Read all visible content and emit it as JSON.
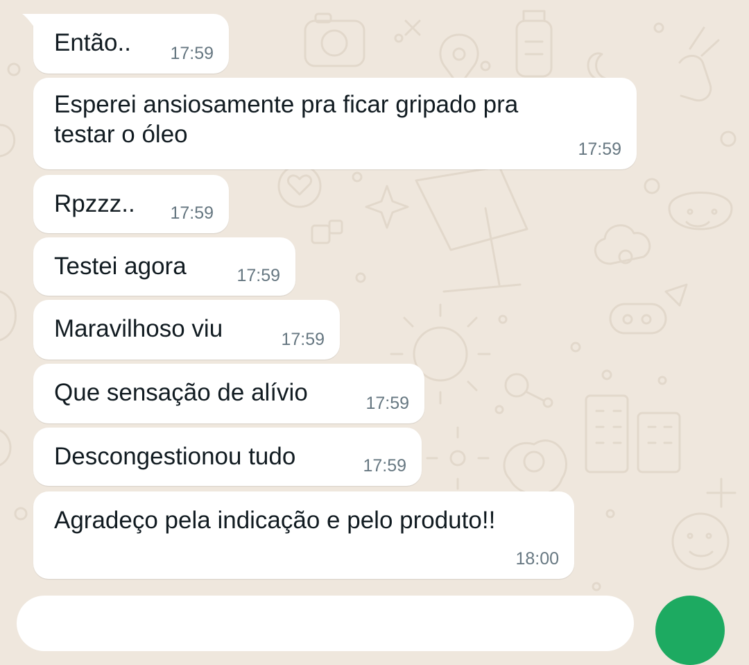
{
  "colors": {
    "background": "#efe7dd",
    "bubble": "#ffffff",
    "text": "#111b21",
    "timestamp": "#667781",
    "send_button": "#1daa61"
  },
  "messages": [
    {
      "text": "Então..",
      "time": "17:59"
    },
    {
      "text": "Esperei ansiosamente pra ficar gripado pra\ntestar o óleo",
      "time": "17:59"
    },
    {
      "text": "Rpzzz..",
      "time": "17:59"
    },
    {
      "text": "Testei agora",
      "time": "17:59"
    },
    {
      "text": "Maravilhoso viu",
      "time": "17:59"
    },
    {
      "text": "Que sensação de alívio",
      "time": "17:59"
    },
    {
      "text": "Descongestionou tudo",
      "time": "17:59"
    },
    {
      "text": "Agradeço pela indicação e pelo produto!!",
      "time": "18:00"
    }
  ],
  "composer": {
    "icon": "send-icon"
  }
}
